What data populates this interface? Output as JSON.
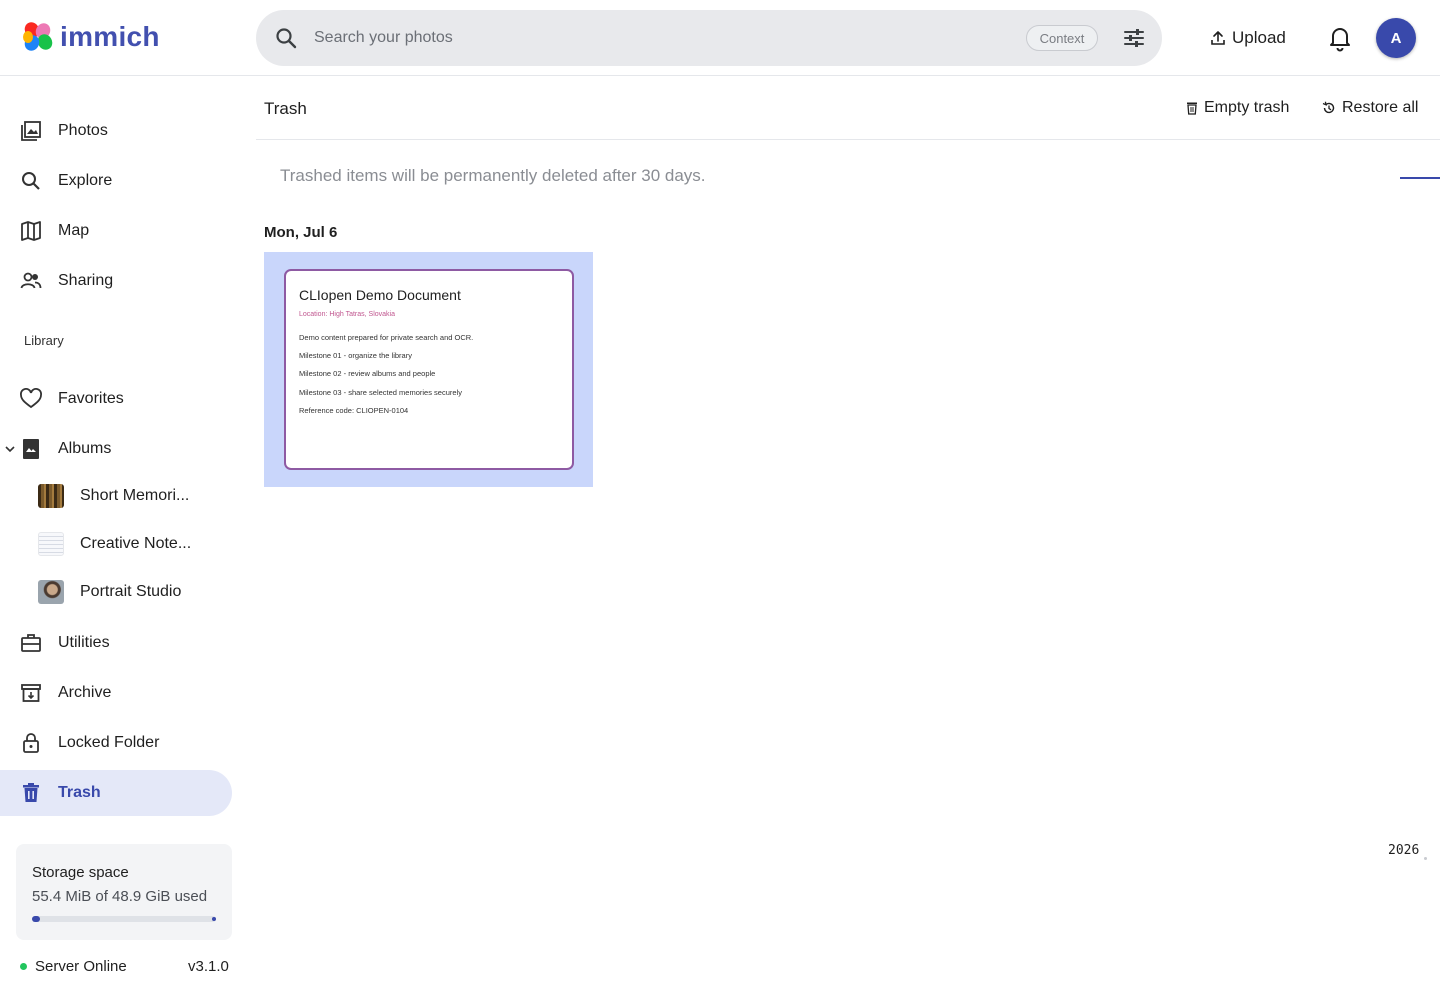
{
  "app": {
    "name": "immich"
  },
  "search": {
    "placeholder": "Search your photos",
    "context_label": "Context"
  },
  "topbar": {
    "upload_label": "Upload",
    "avatar_initial": "A"
  },
  "sidebar": {
    "items": [
      {
        "label": "Photos",
        "icon": "photos-icon"
      },
      {
        "label": "Explore",
        "icon": "search-icon"
      },
      {
        "label": "Map",
        "icon": "map-icon"
      },
      {
        "label": "Sharing",
        "icon": "people-icon"
      }
    ],
    "library_label": "Library",
    "library_items": [
      {
        "label": "Favorites",
        "icon": "heart-icon"
      },
      {
        "label": "Albums",
        "icon": "album-icon"
      }
    ],
    "albums": [
      {
        "label": "Short Memori..."
      },
      {
        "label": "Creative Note..."
      },
      {
        "label": "Portrait Studio"
      }
    ],
    "tools": [
      {
        "label": "Utilities",
        "icon": "toolbox-icon"
      },
      {
        "label": "Archive",
        "icon": "archive-icon"
      },
      {
        "label": "Locked Folder",
        "icon": "lock-icon"
      },
      {
        "label": "Trash",
        "icon": "trash-icon",
        "active": true
      }
    ],
    "storage": {
      "title": "Storage space",
      "used_text": "55.4 MiB of 48.9 GiB used",
      "used_fraction": 0.0011
    },
    "server": {
      "status": "Server Online",
      "version": "v3.1.0"
    }
  },
  "main": {
    "title": "Trash",
    "empty_trash_label": "Empty trash",
    "restore_all_label": "Restore all",
    "notice": "Trashed items will be permanently deleted after 30 days.",
    "date_group": "Mon, Jul 6",
    "asset": {
      "doc_title": "CLIopen Demo Document",
      "doc_location": "Location: High Tatras, Slovakia",
      "lines": [
        "Demo content prepared for private search and OCR.",
        "Milestone 01 - organize the library",
        "Milestone 02 - review albums and people",
        "Milestone 03 - share selected memories securely",
        "Reference code: CLIOPEN-0104"
      ]
    },
    "timeline_year": "2026"
  },
  "colors": {
    "accent": "#3949ab",
    "active_bg": "#e4e8f8",
    "selection_bg": "#c9d6fb"
  }
}
